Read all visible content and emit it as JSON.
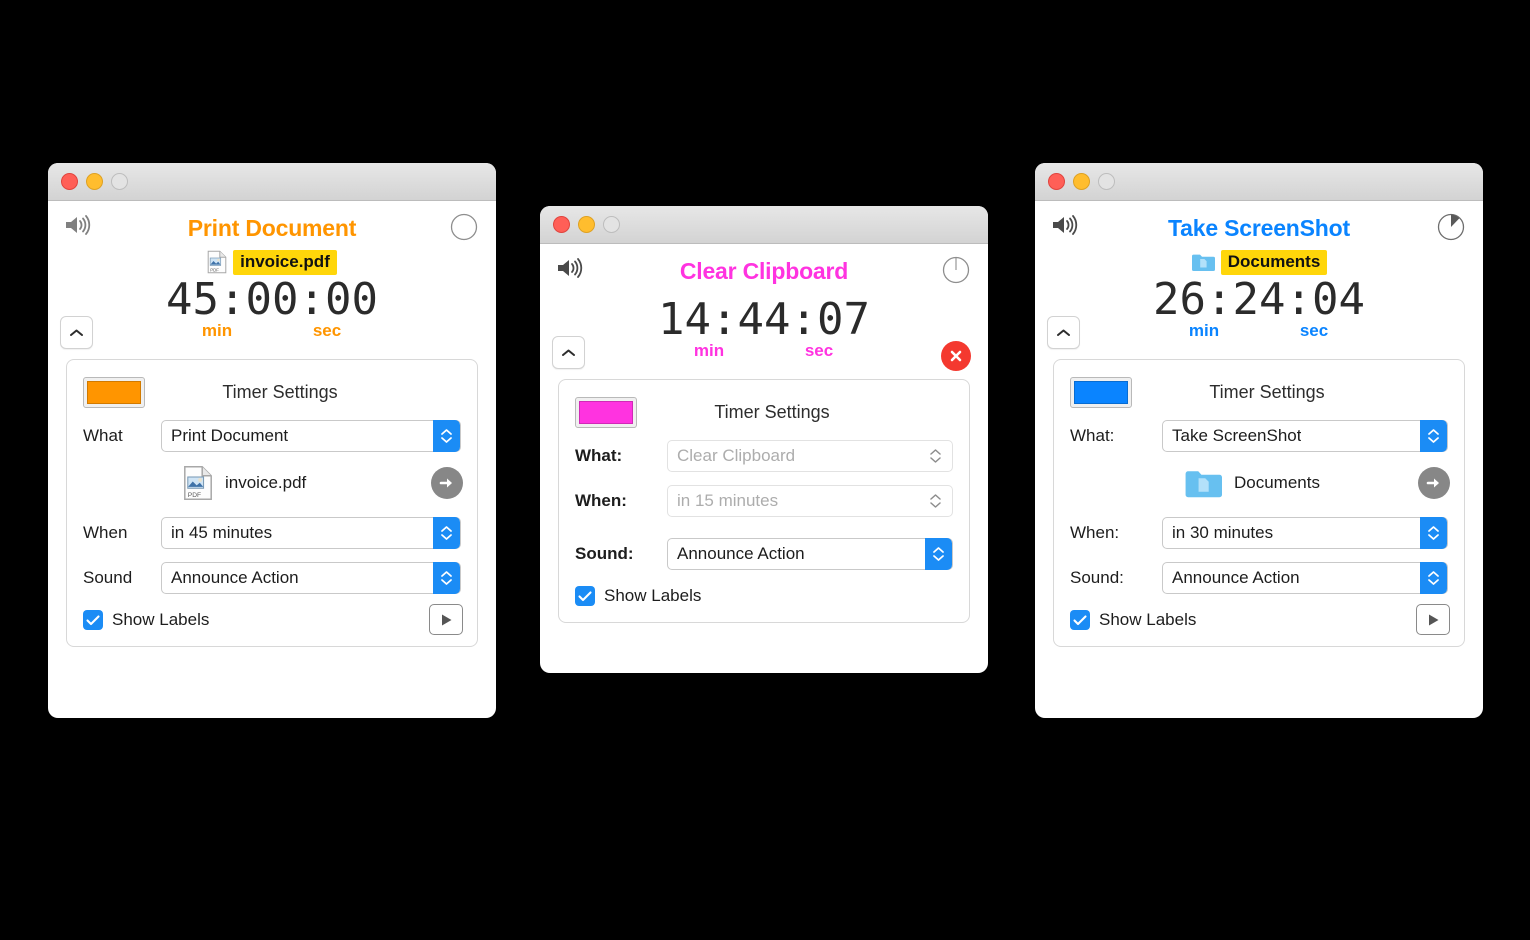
{
  "windows": [
    {
      "id": "print-document",
      "accent": "#ff9500",
      "title": "Print Document",
      "file_name": "invoice.pdf",
      "file_icon": "pdf-document-icon",
      "clock": "45:00:00",
      "unit_min": "min",
      "unit_sec": "sec",
      "progress_pct": 0,
      "speaker_icon": "speaker-icon",
      "collapse_icon": "chevron-up-icon",
      "has_stop_button": false,
      "panel": {
        "title": "Timer Settings",
        "swatch_color": "#ff9500",
        "labels": {
          "what": "What",
          "when": "When",
          "sound": "Sound"
        },
        "what_value": "Print Document",
        "when_value": "in 45 minutes",
        "sound_value": "Announce Action",
        "what_enabled": true,
        "when_enabled": true,
        "sound_enabled": true,
        "show_file_row": true,
        "file_row_name": "invoice.pdf",
        "file_row_icon": "pdf-document-icon",
        "go_icon": "arrow-right-icon",
        "checkbox_label": "Show Labels",
        "checkbox_checked": true,
        "has_play_button": true,
        "play_icon": "play-icon"
      }
    },
    {
      "id": "clear-clipboard",
      "accent": "#ff33e0",
      "title": "Clear Clipboard",
      "file_name": "",
      "file_icon": "",
      "clock": "14:44:07",
      "unit_min": "min",
      "unit_sec": "sec",
      "progress_pct": 0,
      "speaker_icon": "speaker-icon",
      "collapse_icon": "chevron-up-icon",
      "has_stop_button": true,
      "stop_icon": "stop-x-icon",
      "panel": {
        "title": "Timer Settings",
        "swatch_color": "#ff33e0",
        "labels": {
          "what": "What:",
          "when": "When:",
          "sound": "Sound:"
        },
        "what_value": "Clear Clipboard",
        "when_value": "in 15 minutes",
        "sound_value": "Announce Action",
        "what_enabled": false,
        "when_enabled": false,
        "sound_enabled": true,
        "show_file_row": false,
        "file_row_name": "",
        "file_row_icon": "",
        "go_icon": "",
        "checkbox_label": "Show Labels",
        "checkbox_checked": true,
        "has_play_button": false,
        "play_icon": ""
      }
    },
    {
      "id": "take-screenshot",
      "accent": "#0a84ff",
      "title": "Take ScreenShot",
      "file_name": "Documents",
      "file_icon": "folder-icon",
      "clock": "26:24:04",
      "unit_min": "min",
      "unit_sec": "sec",
      "progress_pct": 12,
      "speaker_icon": "speaker-icon",
      "collapse_icon": "chevron-up-icon",
      "has_stop_button": false,
      "panel": {
        "title": "Timer Settings",
        "swatch_color": "#0a84ff",
        "labels": {
          "what": "What:",
          "when": "When:",
          "sound": "Sound:"
        },
        "what_value": "Take ScreenShot",
        "when_value": "in 30 minutes",
        "sound_value": "Announce Action",
        "what_enabled": true,
        "when_enabled": true,
        "sound_enabled": true,
        "show_file_row": true,
        "file_row_name": "Documents",
        "file_row_icon": "folder-icon",
        "go_icon": "arrow-right-icon",
        "checkbox_label": "Show Labels",
        "checkbox_checked": true,
        "has_play_button": true,
        "play_icon": "play-icon"
      }
    }
  ],
  "traffic_lights": {
    "close": "close-button",
    "minimize": "minimize-button",
    "zoom": "zoom-button"
  }
}
